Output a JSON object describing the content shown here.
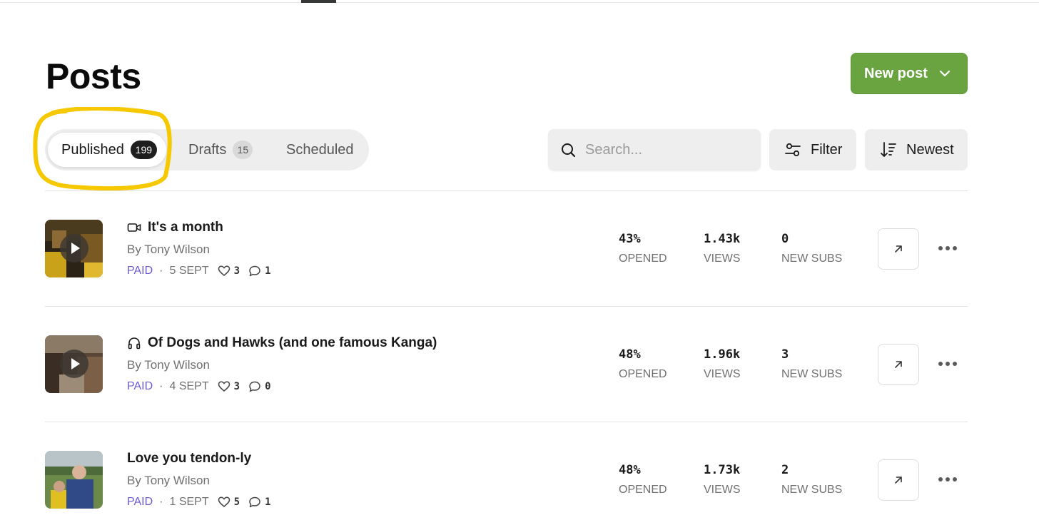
{
  "page": {
    "title": "Posts"
  },
  "actions": {
    "new_post_label": "New post"
  },
  "tabs": [
    {
      "label": "Published",
      "count": "199",
      "active": true
    },
    {
      "label": "Drafts",
      "count": "15",
      "active": false
    },
    {
      "label": "Scheduled",
      "active": false
    }
  ],
  "search": {
    "placeholder": "Search..."
  },
  "toolbar": {
    "filter_label": "Filter",
    "sort_label": "Newest"
  },
  "stat_labels": {
    "opened": "OPENED",
    "views": "VIEWS",
    "new_subs": "NEW SUBS"
  },
  "posts": [
    {
      "title": "It's a month",
      "type_icon": "video-icon",
      "author": "By Tony Wilson",
      "access": "PAID",
      "date": "5 SEPT",
      "likes": "3",
      "comments": "1",
      "opened": "43%",
      "views": "1.43k",
      "new_subs": "0",
      "has_play_overlay": true
    },
    {
      "title": "Of Dogs and Hawks (and one famous Kanga)",
      "type_icon": "headphones-icon",
      "author": "By Tony Wilson",
      "access": "PAID",
      "date": "4 SEPT",
      "likes": "3",
      "comments": "0",
      "opened": "48%",
      "views": "1.96k",
      "new_subs": "3",
      "has_play_overlay": true
    },
    {
      "title": "Love you tendon-ly",
      "type_icon": null,
      "author": "By Tony Wilson",
      "access": "PAID",
      "date": "1 SEPT",
      "likes": "5",
      "comments": "1",
      "opened": "48%",
      "views": "1.73k",
      "new_subs": "2",
      "has_play_overlay": false
    }
  ],
  "colors": {
    "accent_green": "#6aa440",
    "paid_purple": "#6b5cd6",
    "highlight_yellow": "#f5c800"
  }
}
